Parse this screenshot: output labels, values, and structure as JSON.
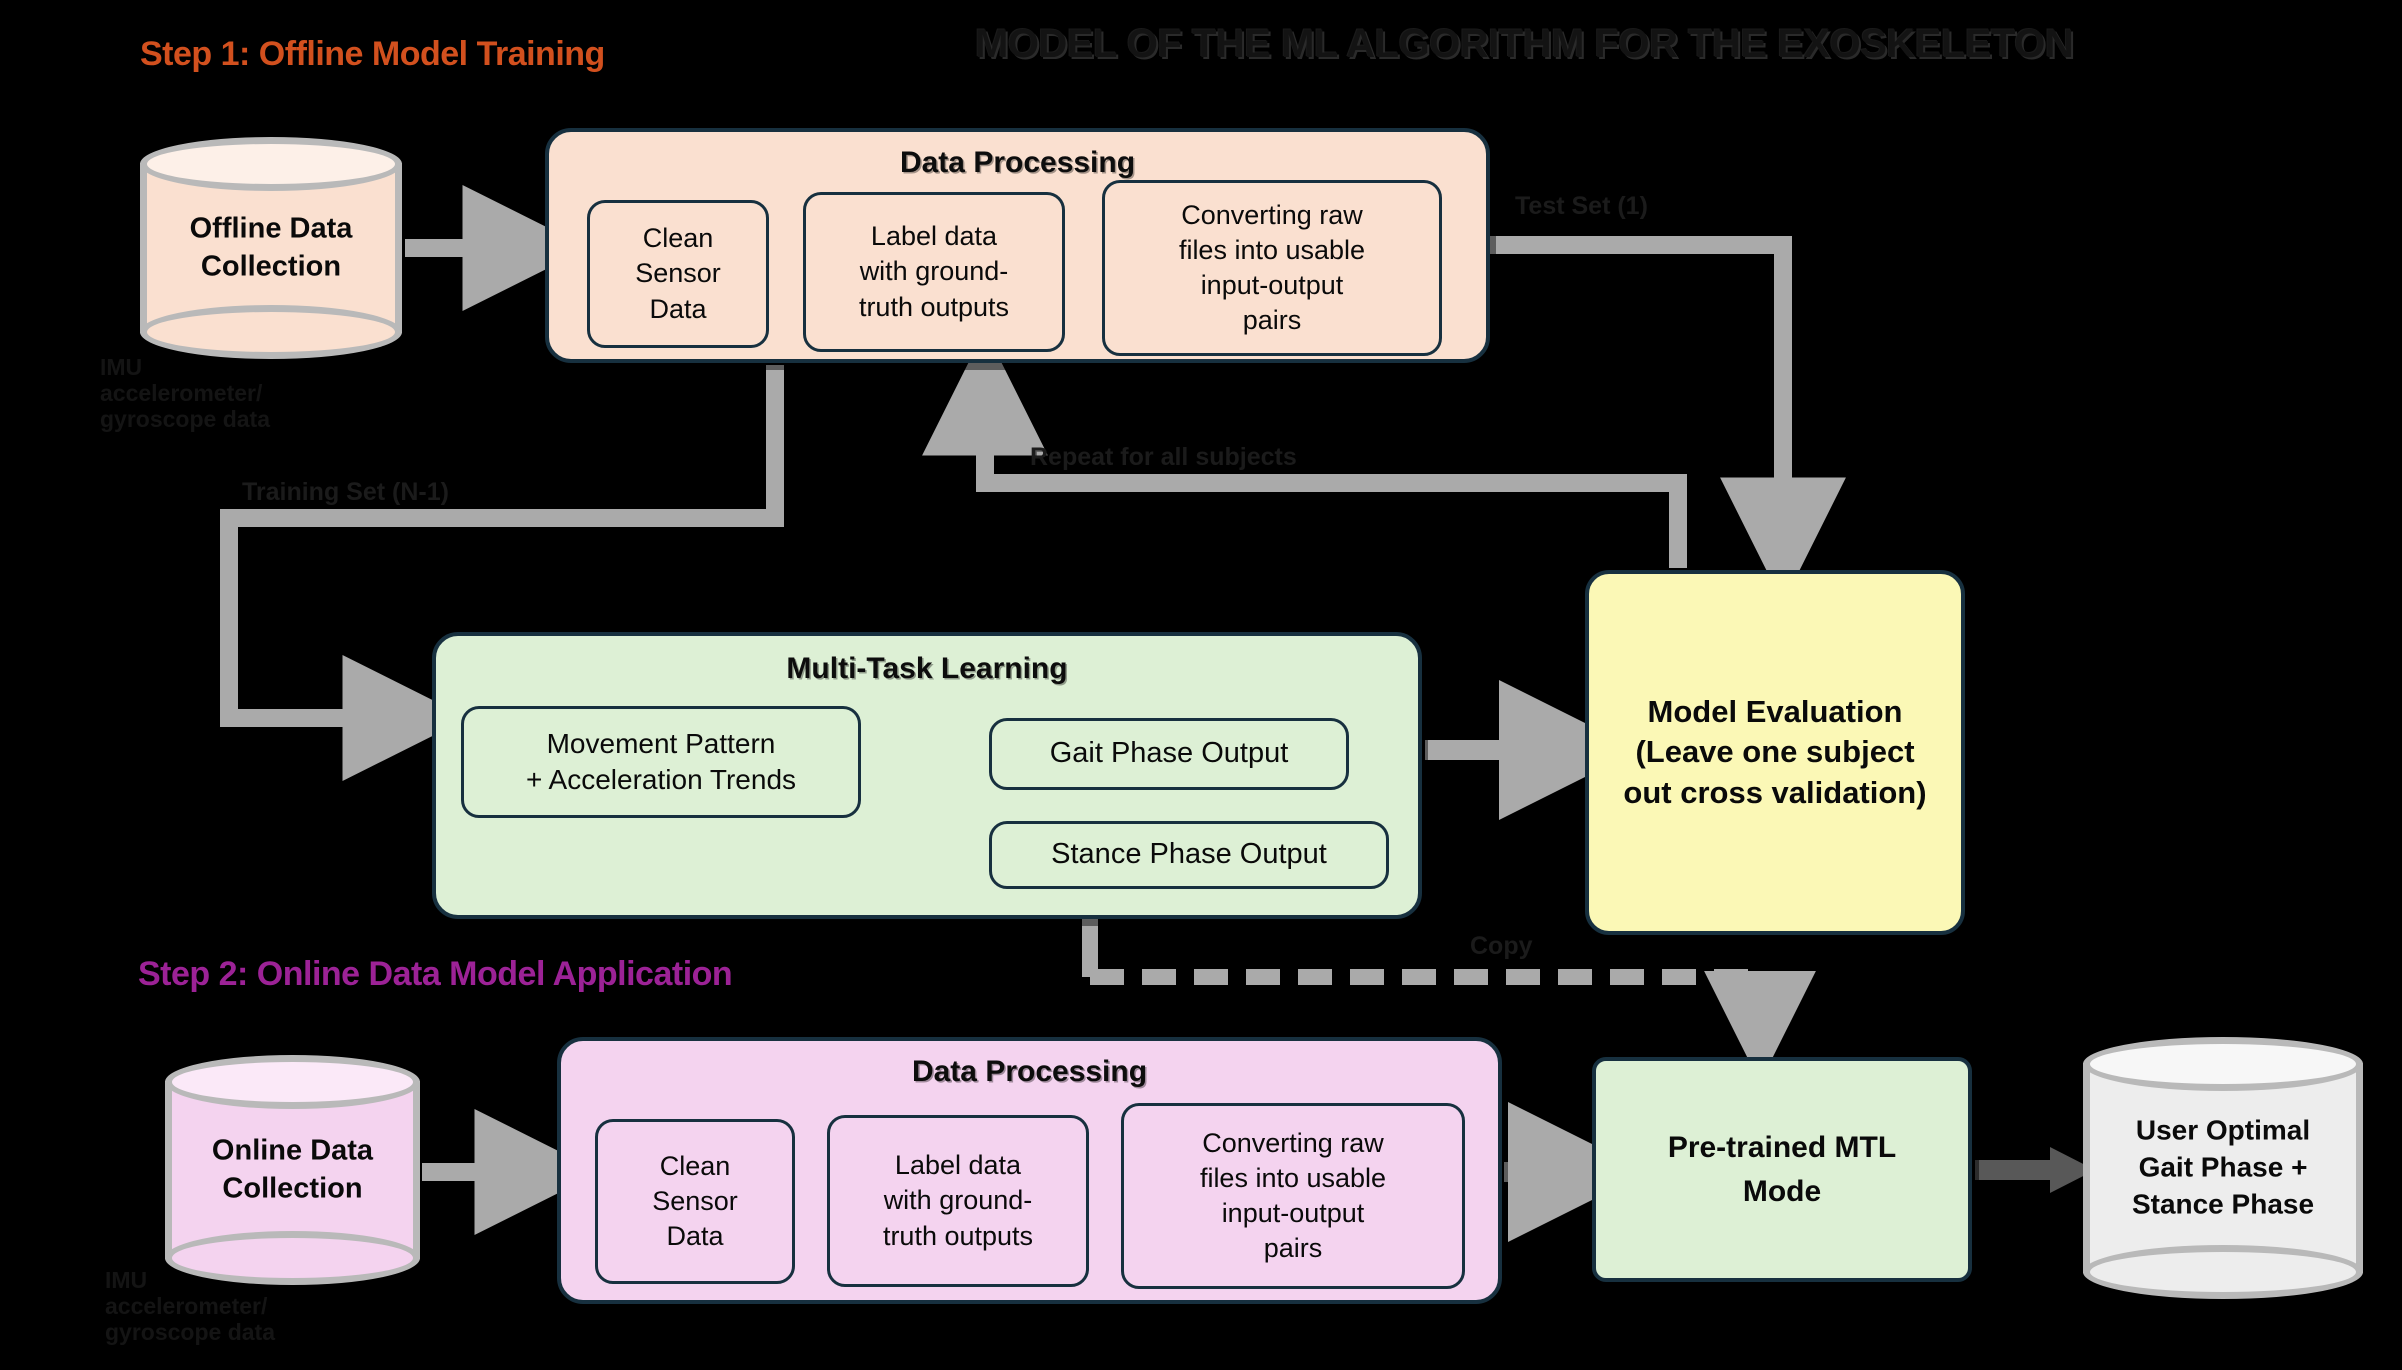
{
  "title": "MODEL OF THE ML ALGORITHM FOR THE EXOSKELETON",
  "steps": {
    "step1": "Step 1: Offline Model Training",
    "step2": "Step 2: Online Data Model Application"
  },
  "colors": {
    "step1_accent": "#d2501e",
    "step2_accent": "#9c2296",
    "offline_fill": "#fae0d0",
    "online_fill": "#f4d3ef",
    "mtl_fill": "#ddf0d5",
    "eval_fill": "#fbf8b6",
    "output_fill": "#efefef",
    "border": "#17303f",
    "arrow": "#aaaaaa",
    "mtl_arrow": "#1b3a4d"
  },
  "offline": {
    "source": {
      "label": "Offline Data\nCollection",
      "caption": "IMU\naccelerometer/\ngyroscope data"
    },
    "data_processing": {
      "title": "Data Processing",
      "boxes": [
        "Clean\nSensor\nData",
        "Label data\nwith ground-\ntruth outputs",
        "Converting raw\nfiles into usable\ninput-output\npairs"
      ]
    }
  },
  "mtl": {
    "title": "Multi-Task Learning",
    "input": "Movement Pattern\n+ Acceleration Trends",
    "outputs": [
      "Gait Phase Output",
      "Stance Phase Output"
    ]
  },
  "evaluation": {
    "label": "Model Evaluation\n(Leave one subject\nout cross validation)"
  },
  "online": {
    "source": {
      "label": "Online  Data\nCollection",
      "caption": "IMU\naccelerometer/\ngyroscope data"
    },
    "data_processing": {
      "title": "Data Processing",
      "boxes": [
        "Clean\nSensor\nData",
        "Label data\nwith ground-\ntruth outputs",
        "Converting raw\nfiles into usable\ninput-output\npairs"
      ]
    },
    "model": "Pre-trained MTL\nMode",
    "output": "User Optimal\nGait Phase +\nStance Phase"
  },
  "wire_labels": {
    "test_set": "Test Set (1)",
    "training_set": "Training Set (N-1)",
    "repeat": "Repeat for all subjects",
    "copy": "Copy"
  }
}
